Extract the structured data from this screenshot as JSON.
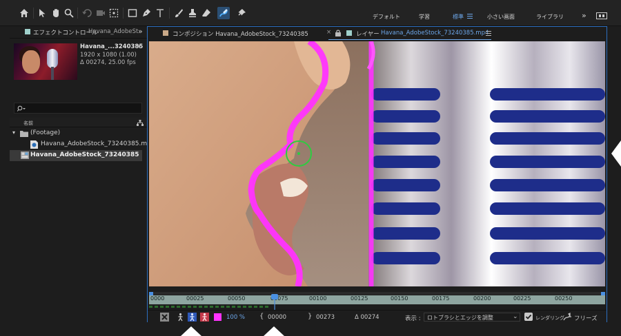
{
  "workspaces": [
    "デフォルト",
    "学習",
    "標準",
    "小さい画面",
    "ライブラリ"
  ],
  "active_workspace": "標準",
  "left_panel": {
    "tab_label": "エフェクトコントロール",
    "tab_file": "Havana_AdobeSt",
    "footage_name": "Havana_...3240385",
    "resolution": "1920 x 1080 (1.00)",
    "duration": "Δ 00274, 25.00 fps",
    "column_name": "名前",
    "items": [
      {
        "label": "(Footage)"
      },
      {
        "label": "Havana_AdobeStock_73240385.m"
      },
      {
        "label": "Havana_AdobeStock_73240385"
      }
    ]
  },
  "viewer": {
    "comp_tab": "コンポジション  Havana_AdobeStock_73240385",
    "layer_tab_prefix": "レイヤー",
    "layer_tab_name": "Havana_AdobeStock_73240385.mp4",
    "ruler_ticks": [
      "0000",
      "00025",
      "00050",
      "00075",
      "00100",
      "00125",
      "00150",
      "00175",
      "00200",
      "00225",
      "00250"
    ],
    "zoom": "100 %",
    "in_point": "00000",
    "out_point": "00273",
    "duration": "Δ 00274",
    "view_label": "表示 :",
    "view_value": "ロトブラシとエッジを調整",
    "render_label": "レンダリング",
    "freeze_label": "フリーズ"
  },
  "colors": {
    "accent": "#2d6fc0",
    "active_workspace": "#6da7ea",
    "roto_outline": "#ff33ff",
    "brush_cursor": "#2ecc40",
    "ruler": "#8ea5a0"
  }
}
